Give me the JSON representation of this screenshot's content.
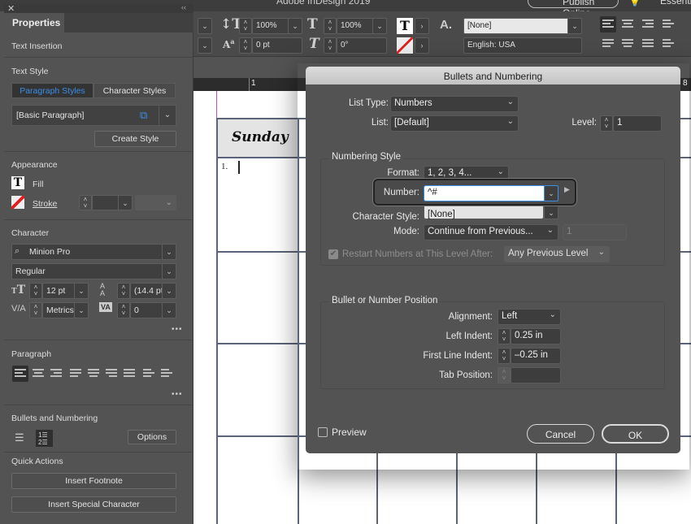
{
  "app": {
    "title": "Adobe InDesign 2019",
    "publish_label": "Publish Online",
    "workspace_label": "Essenti"
  },
  "control_bar": {
    "vertical_scale": "100%",
    "horizontal_scale": "100%",
    "baseline_shift": "0 pt",
    "skew": "0°",
    "char_style": "[None]",
    "language": "English: USA",
    "icons": [
      "vertical-scale-icon",
      "horizontal-scale-icon",
      "baseline-shift-icon",
      "skew-icon",
      "fill-text-icon",
      "stroke-none-icon",
      "char-style-icon"
    ]
  },
  "ruler": {
    "mark": "1",
    "mark_right": "8"
  },
  "document": {
    "header_day": "Sunday",
    "list_number": "1."
  },
  "properties": {
    "tab": "Properties",
    "text_insertion": "Text Insertion",
    "text_style": {
      "title": "Text Style",
      "tabs": [
        "Paragraph Styles",
        "Character Styles"
      ],
      "active_tab": "Paragraph Styles",
      "current_style": "[Basic Paragraph]",
      "create_style": "Create Style"
    },
    "appearance": {
      "title": "Appearance",
      "fill": "Fill",
      "stroke": "Stroke"
    },
    "character": {
      "title": "Character",
      "font": "Minion Pro",
      "style": "Regular",
      "size": "12 pt",
      "leading": "(14.4 pt",
      "kerning": "Metrics",
      "tracking": "0"
    },
    "paragraph": {
      "title": "Paragraph"
    },
    "bullets": {
      "title": "Bullets and Numbering",
      "options": "Options"
    },
    "quick_actions": {
      "title": "Quick Actions",
      "buttons": [
        "Insert Footnote",
        "Insert Special Character"
      ]
    },
    "more": "•••"
  },
  "dialog": {
    "title": "Bullets and Numbering",
    "list_type_label": "List Type:",
    "list_type": "Numbers",
    "list_label": "List:",
    "list": "[Default]",
    "level_label": "Level:",
    "level": "1",
    "numbering_style": {
      "title": "Numbering Style",
      "format_label": "Format:",
      "format": "1, 2, 3, 4...",
      "number_label": "Number:",
      "number": "^#",
      "char_style_label": "Character Style:",
      "char_style": "[None]",
      "mode_label": "Mode:",
      "mode": "Continue from Previous...",
      "start_at": "1",
      "restart_label": "Restart Numbers at This Level After:",
      "restart_checked": true,
      "restart_value": "Any Previous Level"
    },
    "position": {
      "title": "Bullet or Number Position",
      "alignment_label": "Alignment:",
      "alignment": "Left",
      "left_indent_label": "Left Indent:",
      "left_indent": "0.25 in",
      "first_line_label": "First Line Indent:",
      "first_line": "–0.25 in",
      "tab_label": "Tab Position:",
      "tab": ""
    },
    "preview_label": "Preview",
    "preview_checked": false,
    "cancel": "Cancel",
    "ok": "OK"
  },
  "colors": {
    "accent": "#3b8ee8",
    "panel": "#535353",
    "dark": "#3d3d3d"
  }
}
